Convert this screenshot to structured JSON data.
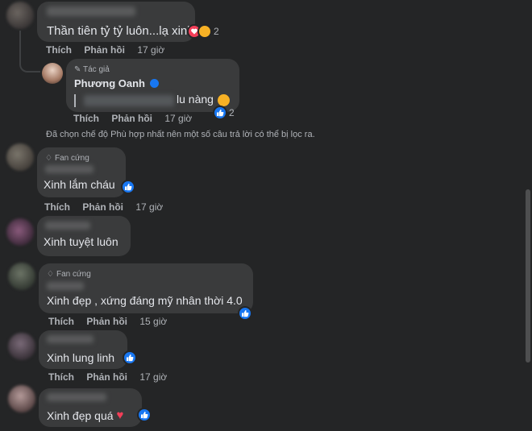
{
  "comments": [
    {
      "text": "Thần tiên tỷ tỷ luôn...lạ xinh",
      "reaction_count": "2",
      "actions": {
        "like": "Thích",
        "reply": "Phản hồi",
        "time": "17 giờ"
      }
    },
    {
      "text": "Xinh lắm cháu",
      "badge": "Fan cứng",
      "actions": {
        "like": "Thích",
        "reply": "Phản hồi",
        "time": "17 giờ"
      }
    },
    {
      "text": "Xinh tuyệt luôn"
    },
    {
      "text": "Xinh đẹp , xứng đáng mỹ nhân thời 4.0",
      "badge": "Fan cứng",
      "actions": {
        "like": "Thích",
        "reply": "Phản hồi",
        "time": "15 giờ"
      }
    },
    {
      "text": "Xinh lung linh",
      "actions": {
        "like": "Thích",
        "reply": "Phản hồi",
        "time": "17 giờ"
      }
    },
    {
      "text": "Xinh đẹp quá"
    }
  ],
  "reply": {
    "author_badge": "Tác giả",
    "author_name": "Phương Oanh",
    "text": "lu nàng",
    "reaction_count": "2",
    "actions": {
      "like": "Thích",
      "reply": "Phản hồi",
      "time": "17 giờ"
    }
  },
  "filter_notice": "Đã chọn chế độ Phù hợp nhất nên một số câu trả lời có thể bị lọc ra.",
  "colors": {
    "background": "#242526",
    "bubble": "#3a3b3c",
    "like_blue": "#1877f2",
    "heart": "#f33e58"
  }
}
